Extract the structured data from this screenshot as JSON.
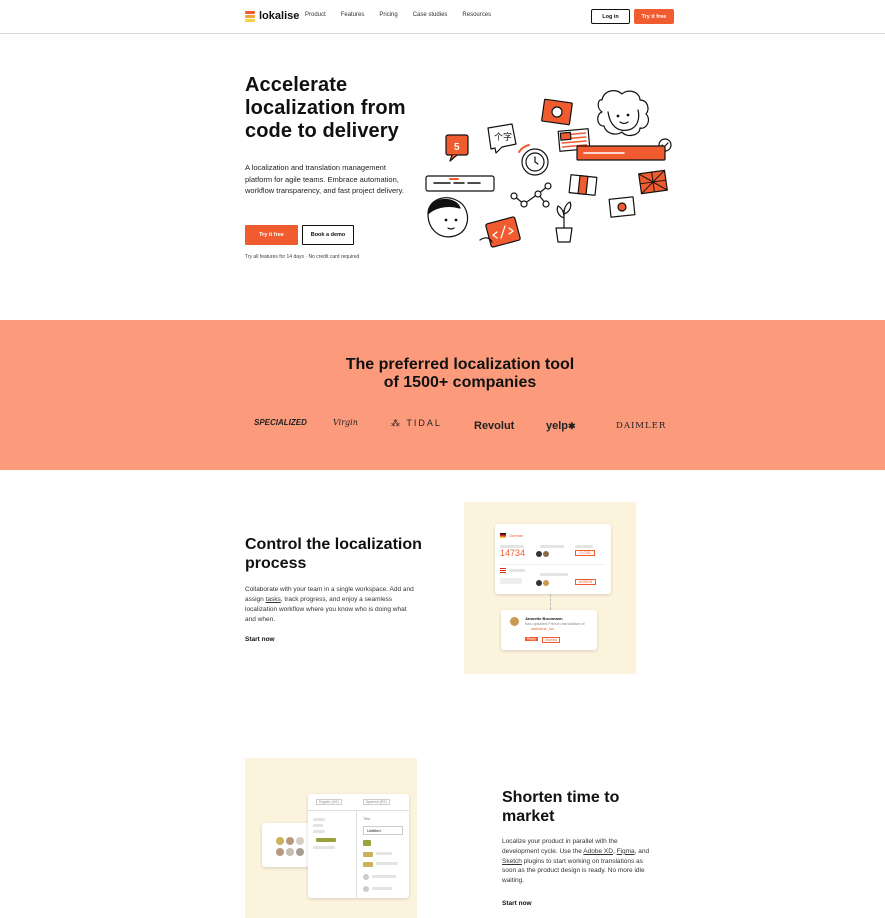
{
  "nav": {
    "logo_text": "lokalise",
    "links": [
      "Product",
      "Features",
      "Pricing",
      "Case studies",
      "Resources"
    ],
    "login_label": "Log in",
    "try_label": "Try it free"
  },
  "hero": {
    "title": "Accelerate localization from code to delivery",
    "subtitle": "A localization and translation management platform for agile teams. Embrace automation, workflow transparency, and fast project delivery.",
    "cta_primary": "Try it free",
    "cta_secondary": "Book a demo",
    "note": "Try all features for 14 days · No credit card required"
  },
  "band": {
    "title_line1": "The preferred localization tool",
    "title_line2": "of 1500+ companies",
    "brands": [
      "SPECIALIZED",
      "Virgin",
      "TIDAL",
      "Revolut",
      "yelp",
      "DAIMLER"
    ]
  },
  "feature1": {
    "title": "Control the localization process",
    "text_pre": "Collaborate with your team in a single workspace. Add and assign ",
    "text_link": "tasks",
    "text_post": ", track progress, and enjoy a seamless localization workflow where you know who is doing what and when.",
    "link": "Start now",
    "mock": {
      "lang": "German",
      "count": "14734",
      "badge_top": "CLOSE",
      "badge_bottom": "ASSIGN",
      "notif_name": "Jannette Brunmann",
      "notif_action": "has updated French translation of",
      "notif_key": "welcome_scr",
      "notif_btn1": "Reply",
      "notif_btn2": "Dismiss"
    }
  },
  "feature2": {
    "title": "Shorten time to market",
    "text_pre": "Localize your product in parallel with the development cycle. Use the ",
    "link_xd": "Adobe XD",
    "sep1": ", ",
    "link_figma": "Figma",
    "sep2": ", and ",
    "link_sketch": "Sketch",
    "text_post": " plugins to start working on translations as soon as the product design is ready. No more idle waiting.",
    "link": "Start now",
    "mock": {
      "lang_a": "English (US)",
      "lang_b": "Spanish (ES)",
      "field": "Title",
      "value": "Untitled"
    }
  },
  "colors": {
    "accent": "#f05c30",
    "band": "#fc9b7c",
    "cream": "#fbf3dc"
  }
}
